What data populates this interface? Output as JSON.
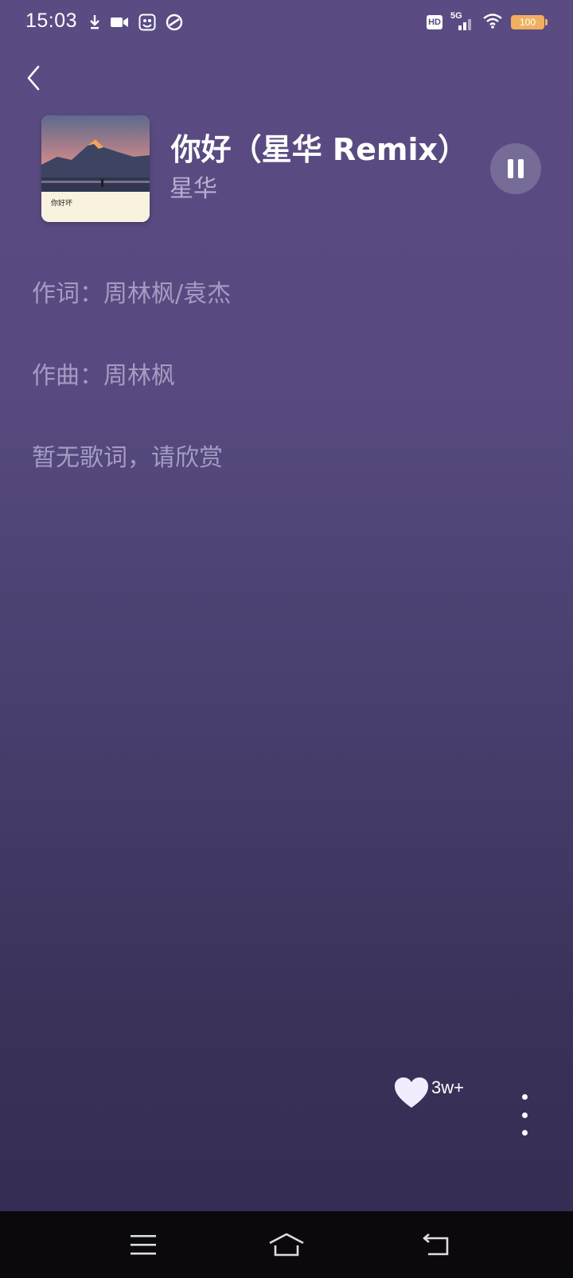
{
  "status_bar": {
    "time": "15:03",
    "left_icons": [
      "download-icon",
      "video-icon",
      "app-icon",
      "sync-icon"
    ],
    "hd_label": "HD",
    "network_label": "5G",
    "battery_level": "100"
  },
  "header": {
    "back_icon": "chevron-left-icon",
    "song_title": "你好（星华 Remix）",
    "artist": "星华",
    "cover_text": "你好坏",
    "play_state": "pause-icon"
  },
  "lyrics": {
    "lines": [
      "作词：周林枫/袁杰",
      "作曲：周林枫",
      "暂无歌词，请欣赏"
    ]
  },
  "actions": {
    "like_icon": "heart-icon",
    "like_count": "3w+",
    "more_icon": "more-vertical-icon"
  },
  "nav_bar": {
    "items": [
      "menu-icon",
      "home-icon",
      "back-icon"
    ]
  },
  "colors": {
    "background_top": "#5a4c83",
    "background_bottom": "#352c52",
    "lyric_text": "#a59bc3",
    "artist_text": "#b8aed2",
    "battery": "#f0b060"
  }
}
